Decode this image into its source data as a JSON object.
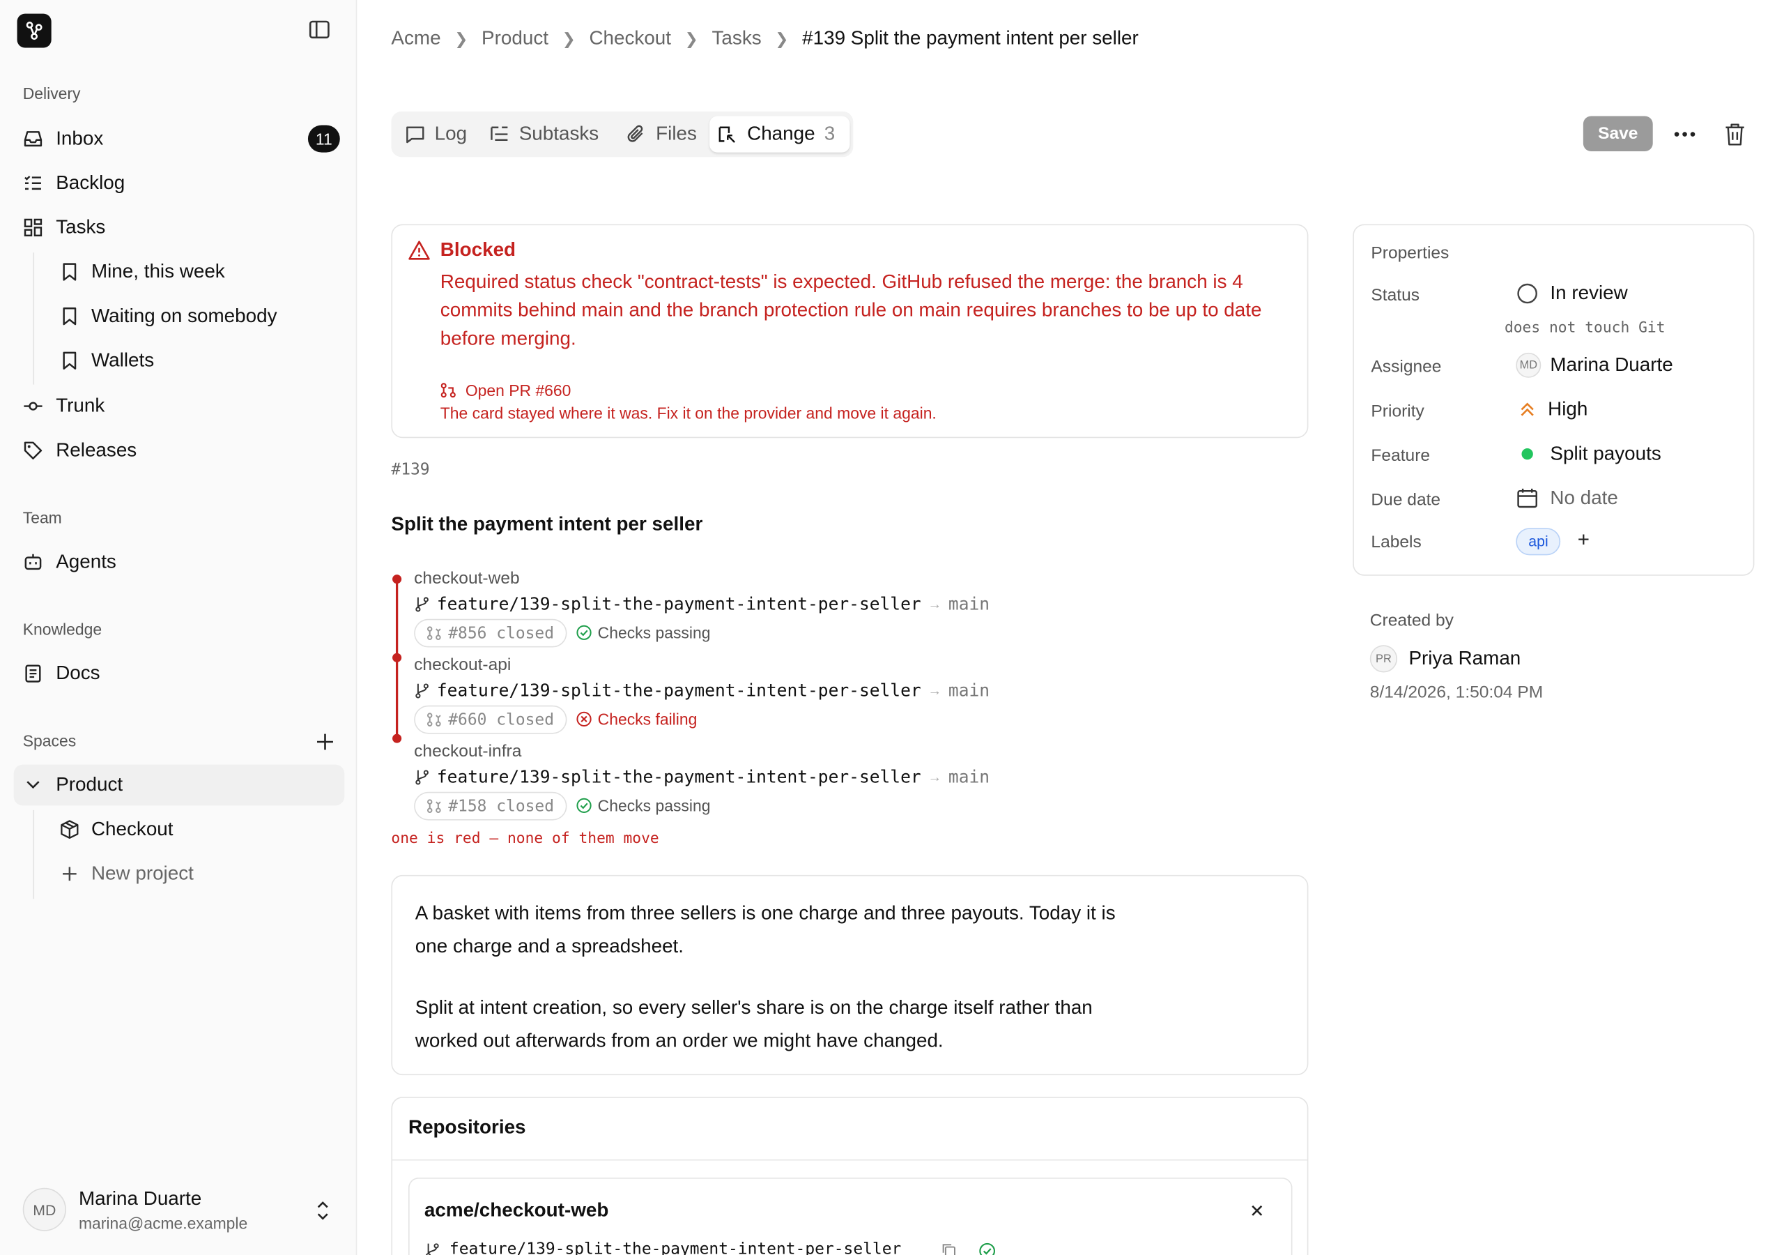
{
  "sidebar": {
    "sections": {
      "delivery": "Delivery",
      "team": "Team",
      "knowledge": "Knowledge",
      "spaces": "Spaces"
    },
    "items": {
      "inbox": {
        "label": "Inbox",
        "badge": "11"
      },
      "backlog": {
        "label": "Backlog"
      },
      "tasks": {
        "label": "Tasks"
      },
      "mine": {
        "label": "Mine, this week"
      },
      "waiting": {
        "label": "Waiting on somebody"
      },
      "wallets": {
        "label": "Wallets"
      },
      "trunk": {
        "label": "Trunk"
      },
      "releases": {
        "label": "Releases"
      },
      "agents": {
        "label": "Agents"
      },
      "docs": {
        "label": "Docs"
      },
      "product": {
        "label": "Product"
      },
      "checkout": {
        "label": "Checkout"
      },
      "new_project": {
        "label": "New project"
      }
    },
    "user": {
      "initials": "MD",
      "name": "Marina Duarte",
      "email": "marina@acme.example"
    }
  },
  "breadcrumb": [
    "Acme",
    "Product",
    "Checkout",
    "Tasks",
    "#139 Split the payment intent per seller"
  ],
  "tabs": {
    "log": "Log",
    "subtasks": "Subtasks",
    "files": "Files",
    "change": "Change",
    "change_count": "3"
  },
  "toolbar": {
    "save_label": "Save"
  },
  "blocked": {
    "title": "Blocked",
    "message": "Required status check \"contract-tests\" is expected. GitHub refused the merge: the branch is 4 commits behind main and the branch protection rule on main requires branches to be up to date before merging.",
    "pr_link": "Open PR #660",
    "note": "The card stayed where it was. Fix it on the provider and move it again."
  },
  "task": {
    "id": "#139",
    "title": "Split the payment intent per seller"
  },
  "change_repos": [
    {
      "repo": "checkout-web",
      "branch": "feature/139-split-the-payment-intent-per-seller",
      "target": "main",
      "pr": "#856 closed",
      "checks": "Checks passing",
      "status": "passing"
    },
    {
      "repo": "checkout-api",
      "branch": "feature/139-split-the-payment-intent-per-seller",
      "target": "main",
      "pr": "#660 closed",
      "checks": "Checks failing",
      "status": "failing"
    },
    {
      "repo": "checkout-infra",
      "branch": "feature/139-split-the-payment-intent-per-seller",
      "target": "main",
      "pr": "#158 closed",
      "checks": "Checks passing",
      "status": "passing"
    }
  ],
  "change_summary": "one is red — none of them move",
  "description": {
    "p1_line1": "A basket with items from three sellers is one charge and three payouts. Today it is",
    "p1_line2": "one charge and a spreadsheet.",
    "p2_line1": "Split at intent creation, so every seller's share is on the charge itself rather than",
    "p2_line2": "worked out afterwards from an order we might have changed."
  },
  "repositories": {
    "title": "Repositories",
    "first": {
      "name": "acme/checkout-web",
      "branch": "feature/139-split-the-payment-intent-per-seller"
    }
  },
  "properties": {
    "title": "Properties",
    "status_label": "Status",
    "status": "In review",
    "status_note": "does not touch Git",
    "assignee_label": "Assignee",
    "assignee_initials": "MD",
    "assignee": "Marina Duarte",
    "priority_label": "Priority",
    "priority": "High",
    "feature_label": "Feature",
    "feature": "Split payouts",
    "due_label": "Due date",
    "due": "No date",
    "labels_label": "Labels",
    "label_api": "api",
    "label_add": "+"
  },
  "created": {
    "label": "Created by",
    "initials": "PR",
    "name": "Priya Raman",
    "date": "8/14/2026, 1:50:04 PM"
  },
  "colors": {
    "danger": "#c5221f",
    "success": "#1e9e4a",
    "priority": "#e67e22",
    "feature_dot": "#22c55e",
    "label_bg": "#e8f1fd",
    "label_text": "#1a56db"
  }
}
